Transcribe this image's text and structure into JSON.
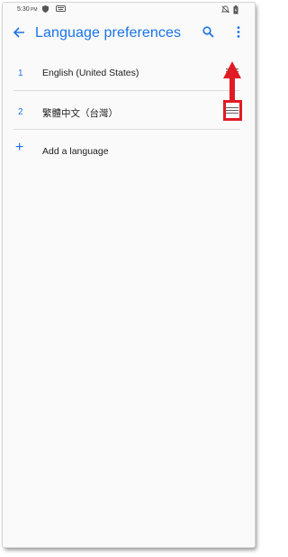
{
  "status_bar": {
    "time": "5:30",
    "ampm": "PM",
    "icons": [
      "shield-icon",
      "keyboard-icon",
      "no-notifications-icon",
      "battery-icon"
    ]
  },
  "app_bar": {
    "title": "Language preferences",
    "back_icon": "arrow-back-icon",
    "search_icon": "search-icon",
    "menu_icon": "more-vert-icon",
    "accent": "#1a73e8"
  },
  "languages": [
    {
      "index": "1",
      "name": "English (United States)"
    },
    {
      "index": "2",
      "name": "繁體中文（台灣）"
    }
  ],
  "add_language": {
    "label": "Add a language",
    "icon": "plus-icon"
  },
  "annotation": {
    "color": "#e01b24",
    "highlight": "drag-handle-icon",
    "arrow": "up-arrow"
  }
}
